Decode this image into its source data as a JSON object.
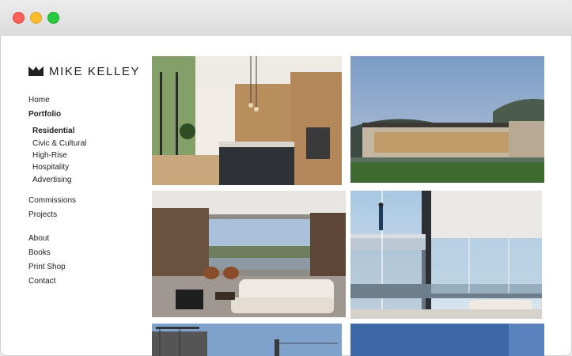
{
  "brand": {
    "name": "MIKE KELLEY"
  },
  "nav": {
    "primary": [
      "Home",
      "Portfolio"
    ],
    "portfolio_sub": [
      "Residential",
      "Civic & Cultural",
      "High-Rise",
      "Hospitality",
      "Advertising"
    ],
    "secondary": [
      "Commissions",
      "Projects"
    ],
    "tertiary": [
      "About",
      "Books",
      "Print Shop",
      "Contact"
    ]
  },
  "icons": [
    "close-window-icon",
    "minimize-window-icon",
    "zoom-window-icon",
    "logo-mark-icon"
  ]
}
